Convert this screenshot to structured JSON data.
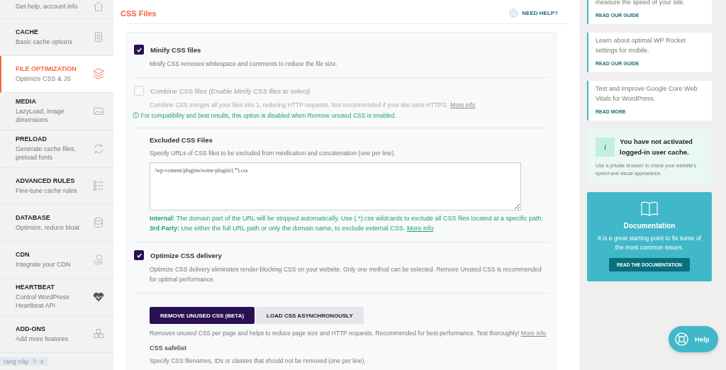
{
  "sidebar": {
    "items": [
      {
        "subtitle": "Get help, account info",
        "selected": false
      },
      {
        "title": "CACHE",
        "subtitle": "Basic cache options",
        "selected": false
      },
      {
        "title": "FILE OPTIMIZATION",
        "subtitle": "Optimize CSS & JS",
        "selected": true
      },
      {
        "title": "MEDIA",
        "subtitle": "LazyLoad, image dimensions",
        "selected": false
      },
      {
        "title": "PRELOAD",
        "subtitle": "Generate cache files, preload fonts",
        "selected": false
      },
      {
        "title": "ADVANCED RULES",
        "subtitle": "Fine-tune cache rules",
        "selected": false
      },
      {
        "title": "DATABASE",
        "subtitle": "Optimize, reduce bloat",
        "selected": false
      },
      {
        "title": "CDN",
        "subtitle": "Integrate your CDN",
        "selected": false
      },
      {
        "title": "HEARTBEAT",
        "subtitle": "Control WordPress Heartbeat API",
        "selected": false
      },
      {
        "title": "ADD-ONS",
        "subtitle": "Add more features",
        "selected": false
      }
    ],
    "translate_bar": {
      "text": "rang này",
      "help": "?",
      "close": "x"
    }
  },
  "main": {
    "heading": "CSS Files",
    "help_link": "NEED HELP?",
    "options": [
      {
        "kind": "checkbox",
        "label": "Minify CSS files",
        "checked": true,
        "disabled": false,
        "description": "Minify CSS removes whitespace and comments to reduce the file size."
      },
      {
        "kind": "checkbox",
        "label": "Combine CSS files",
        "label_note": "(Enable Minify CSS files to select)",
        "checked": false,
        "disabled": true,
        "description": "Combine CSS merges all your files into 1, reducing HTTP requests. Not recommended if your site uses HTTP/2.",
        "link": "More info",
        "notice": "For compatibility and best results, this option is disabled when Remove unused CSS is enabled."
      },
      {
        "kind": "textarea",
        "label": "Excluded CSS Files",
        "description": "Specify URLs of CSS files to be excluded from minification and concatenation (one per line).",
        "value": "/wp-content/plugins/some-plugin/(.*).css",
        "notes": [
          "**Internal:** The domain part of the URL will be stripped automatically. Use (.*).css wildcards to exclude all CSS files located at a specific path.",
          "**3rd Party:** Use either the full URL path or only the domain name, to exclude external CSS."
        ],
        "link": "More info"
      },
      {
        "kind": "checkbox",
        "label": "Optimize CSS delivery",
        "checked": true,
        "disabled": false,
        "description": "Optimize CSS delivery eliminates render-blocking CSS on your website. Only one method can be selected. Remove Unused CSS is recommended for optimal performance."
      },
      {
        "kind": "segmented",
        "choices": [
          {
            "label": "REMOVE UNUSED CSS (BETA)",
            "selected": true
          },
          {
            "label": "LOAD CSS ASYNCHRONOUSLY",
            "selected": false
          }
        ],
        "description": "Removes unused CSS per page and helps to reduce page size and HTTP requests. Recommended for best performance. Test thoroughly!",
        "link": "More info",
        "sub_label": "CSS safelist",
        "sub_description": "Specify CSS filenames, IDs or classes that should not be removed (one per line)."
      }
    ]
  },
  "aside": {
    "guides": [
      {
        "text": "measure the speed of your site.",
        "link": "READ OUR GUIDE"
      },
      {
        "text": "Learn about optimal WP Rocket settings for mobile.",
        "link": "READ OUR GUIDE"
      },
      {
        "text": "Test and Improve Google Core Web Vitals for WordPress.",
        "link": "READ MORE"
      }
    ],
    "notice": {
      "icon_text": "i",
      "title": "You have not activated logged-in user cache.",
      "text": "Use a private browser to check your website's speed and visual appearance."
    },
    "documentation": {
      "title": "Documentation",
      "text": "It is a great starting point to fix some of the most common issues.",
      "button": "READ THE DOCUMENTATION"
    },
    "help_button": "Help"
  }
}
